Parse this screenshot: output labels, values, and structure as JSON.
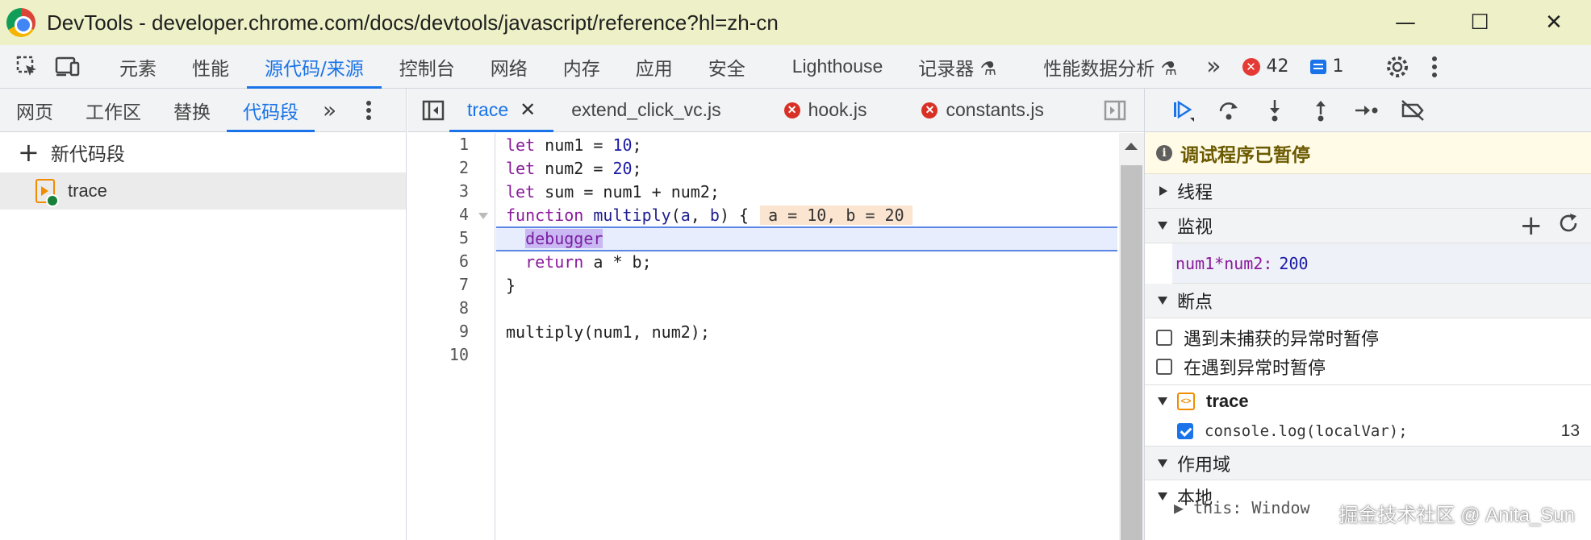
{
  "window": {
    "title": "DevTools - developer.chrome.com/docs/devtools/javascript/reference?hl=zh-cn",
    "minimize": "—",
    "maximize": "☐",
    "close": "✕"
  },
  "main_tabs": [
    {
      "label": "元素"
    },
    {
      "label": "性能"
    },
    {
      "label": "源代码/来源",
      "active": true
    },
    {
      "label": "控制台"
    },
    {
      "label": "网络"
    },
    {
      "label": "内存"
    },
    {
      "label": "应用"
    },
    {
      "label": "安全"
    },
    {
      "label": "Lighthouse"
    },
    {
      "label": "记录器 ⚗"
    },
    {
      "label": "性能数据分析 ⚗"
    }
  ],
  "overflow_tabs": "»",
  "counters": {
    "errors": "42",
    "messages": "1"
  },
  "navigator": {
    "tabs": [
      {
        "label": "网页"
      },
      {
        "label": "工作区"
      },
      {
        "label": "替换"
      },
      {
        "label": "代码段",
        "active": true
      }
    ],
    "more": "»",
    "new_snippet": "新代码段",
    "snippets": [
      {
        "name": "trace"
      }
    ]
  },
  "editor": {
    "tabs": [
      {
        "label": "trace",
        "active": true,
        "closable": true
      },
      {
        "label": "extend_click_vc.js"
      },
      {
        "label": "hook.js",
        "error": true
      },
      {
        "label": "constants.js",
        "error": true
      }
    ],
    "line_numbers": [
      "1",
      "2",
      "3",
      "4",
      "5",
      "6",
      "7",
      "8",
      "9",
      "10"
    ],
    "inline_value": "a = 10, b = 20",
    "paused_line": 5
  },
  "sidebar": {
    "paused_message": "调试程序已暂停",
    "sections": {
      "threads": "线程",
      "watch": "监视",
      "breakpoints": "断点",
      "scope": "作用域"
    },
    "watch": [
      {
        "expression": "num1*num2:",
        "value": "200"
      }
    ],
    "pause_options": [
      {
        "label": "遇到未捕获的异常时暂停",
        "checked": false
      },
      {
        "label": "在遇到异常时暂停",
        "checked": false
      }
    ],
    "breakpoint_file": "trace",
    "breakpoints": [
      {
        "code": "console.log(localVar);",
        "line": "13",
        "checked": true
      }
    ],
    "scope_local": "本地",
    "scope_partial": "▶ this: Window"
  },
  "watermark": "掘金技术社区 @ Anita_Sun",
  "colors": {
    "accent": "#1a73e8",
    "paused_bg": "#fffbe6",
    "exec_line": "#e7edfc",
    "keyword": "#8a1a9b"
  }
}
